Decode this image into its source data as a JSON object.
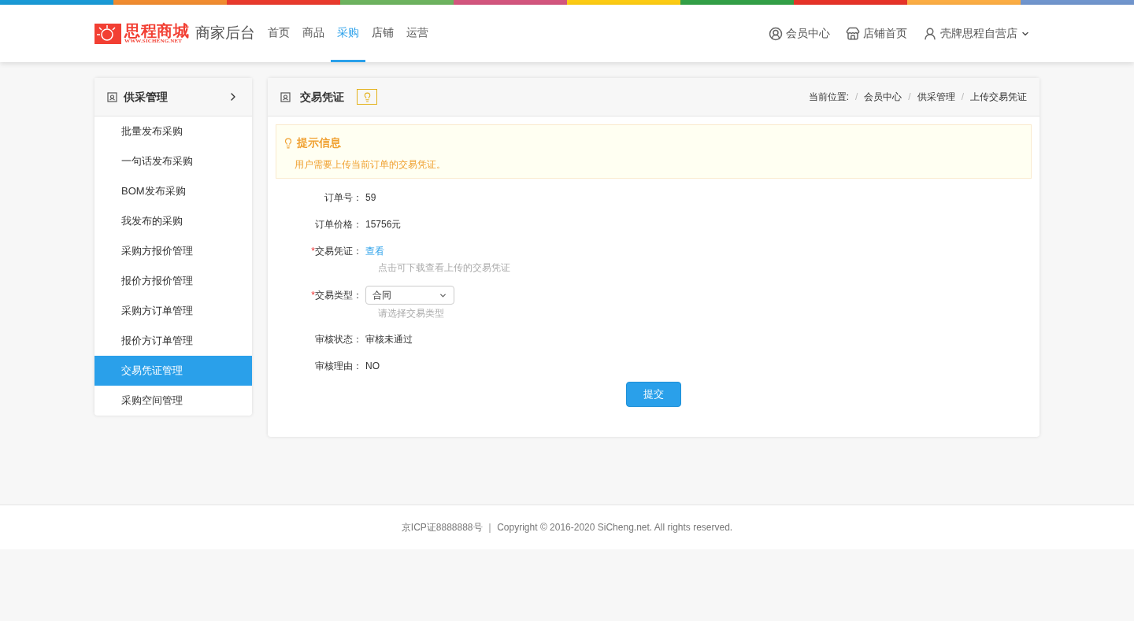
{
  "header": {
    "logo": {
      "name": "思程商城",
      "url": "WWW.SICHENG.NET"
    },
    "title": "商家后台",
    "nav": [
      {
        "label": "首页",
        "selected": false
      },
      {
        "label": "商品",
        "selected": false
      },
      {
        "label": "采购",
        "selected": true
      },
      {
        "label": "店铺",
        "selected": false
      },
      {
        "label": "运营",
        "selected": false
      }
    ],
    "links": [
      {
        "kind": "user",
        "label": "会员中心"
      },
      {
        "kind": "shop",
        "label": "店铺首页"
      },
      {
        "kind": "account",
        "label": "壳牌思程自营店"
      }
    ]
  },
  "sidebar": {
    "title": "供采管理",
    "items": [
      {
        "label": "批量发布采购",
        "selected": false
      },
      {
        "label": "一句话发布采购",
        "selected": false
      },
      {
        "label": "BOM发布采购",
        "selected": false
      },
      {
        "label": "我发布的采购",
        "selected": false
      },
      {
        "label": "采购方报价管理",
        "selected": false
      },
      {
        "label": "报价方报价管理",
        "selected": false
      },
      {
        "label": "采购方订单管理",
        "selected": false
      },
      {
        "label": "报价方订单管理",
        "selected": false
      },
      {
        "label": "交易凭证管理",
        "selected": true
      },
      {
        "label": "采购空间管理",
        "selected": false
      }
    ]
  },
  "panel": {
    "title": "交易凭证",
    "breadcrumb": [
      {
        "kind": "label",
        "text": "当前位置:"
      },
      {
        "kind": "separator",
        "text": "/"
      },
      {
        "kind": "link",
        "text": "会员中心"
      },
      {
        "kind": "separator",
        "text": "/"
      },
      {
        "kind": "link",
        "text": "供采管理"
      },
      {
        "kind": "separator",
        "text": "/"
      },
      {
        "kind": "link",
        "text": "上传交易凭证"
      }
    ],
    "notice": {
      "title": "提示信息",
      "text": "用户需要上传当前订单的交易凭证。"
    },
    "form": [
      {
        "kind": "text",
        "label": "订单号：",
        "value": "59"
      },
      {
        "kind": "text",
        "label": "订单价格：",
        "value": "15756元"
      },
      {
        "kind": "link",
        "required_mark": "*",
        "label": "交易凭证：",
        "value": "查看",
        "hint": "点击可下载查看上传的交易凭证"
      },
      {
        "kind": "select",
        "required_mark": "*",
        "label": "交易类型：",
        "value": "合同",
        "hint": "请选择交易类型"
      },
      {
        "kind": "text",
        "label": "审核状态：",
        "value": "审核未通过"
      },
      {
        "kind": "text",
        "label": "审核理由：",
        "value": "NO"
      }
    ],
    "submit": "提交"
  },
  "footer": "京ICP证8888888号 ｜ Copyright © 2016-2020 SiCheng.net. All rights reserved."
}
